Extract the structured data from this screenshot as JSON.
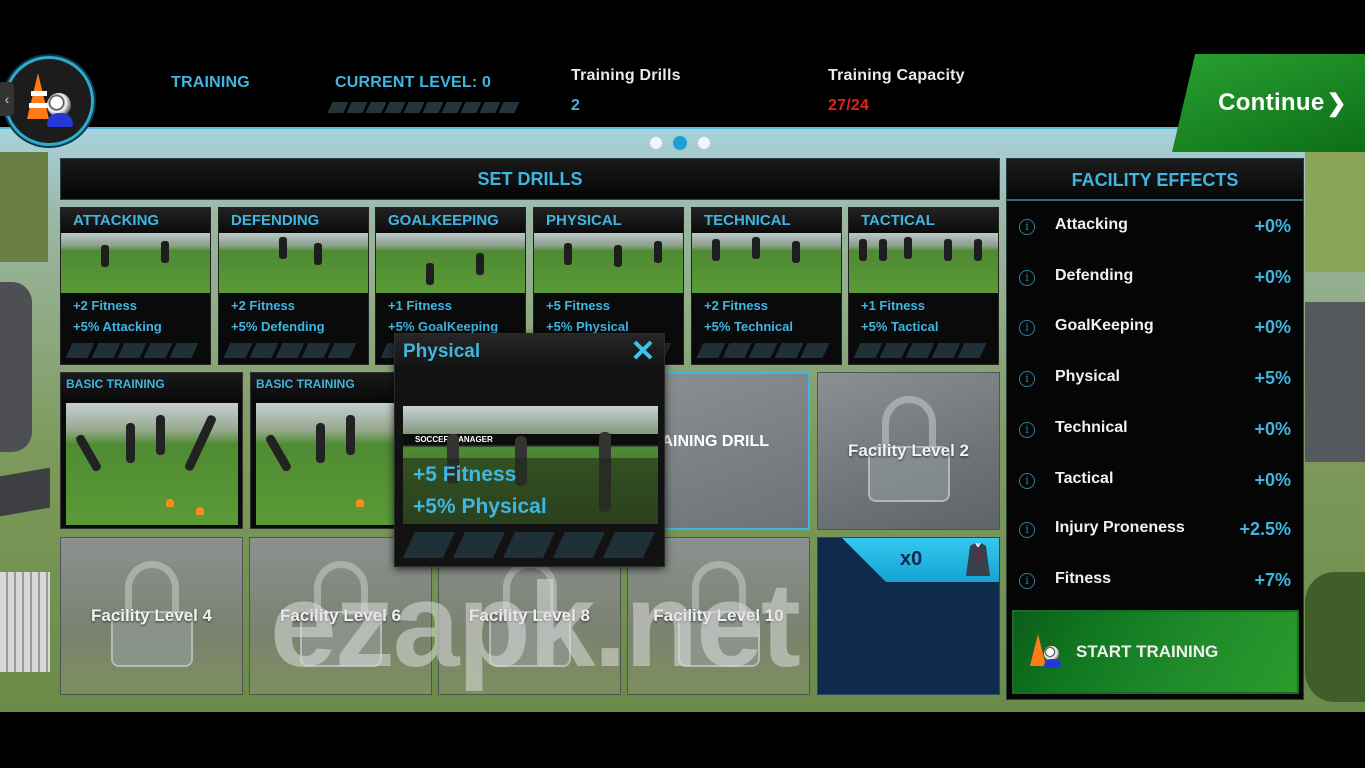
{
  "header": {
    "section_title": "TRAINING",
    "current_level_label": "CURRENT LEVEL: 0",
    "current_level_progress_segments_filled": 0,
    "current_level_progress_segments_total": 10,
    "training_drills_label": "Training Drills",
    "training_drills_value": "2",
    "training_capacity_label": "Training Capacity",
    "training_capacity_value": "27/24",
    "continue_label": "Continue",
    "back_icon": "‹"
  },
  "pagination": {
    "pages": 3,
    "active_index": 1
  },
  "set_drills": {
    "title": "SET DRILLS",
    "categories": [
      {
        "title": "ATTACKING",
        "fitness": "+2 Fitness",
        "bonus": "+5% Attacking",
        "level_filled": 0,
        "level_total": 5
      },
      {
        "title": "DEFENDING",
        "fitness": "+2 Fitness",
        "bonus": "+5% Defending",
        "level_filled": 0,
        "level_total": 5
      },
      {
        "title": "GOALKEEPING",
        "fitness": "+1 Fitness",
        "bonus": "+5% GoalKeeping",
        "level_filled": 0,
        "level_total": 5
      },
      {
        "title": "PHYSICAL",
        "fitness": "+5 Fitness",
        "bonus": "+5% Physical",
        "level_filled": 0,
        "level_total": 5
      },
      {
        "title": "TECHNICAL",
        "fitness": "+2 Fitness",
        "bonus": "+5% Technical",
        "level_filled": 0,
        "level_total": 5
      },
      {
        "title": "TACTICAL",
        "fitness": "+1 Fitness",
        "bonus": "+5% Tactical",
        "level_filled": 0,
        "level_total": 5
      }
    ]
  },
  "slots": {
    "basic_training": [
      {
        "label": "BASIC TRAINING"
      },
      {
        "label": "BASIC TRAINING"
      }
    ],
    "add_drill_label": "ADD TRAINING DRILL +",
    "locked": [
      {
        "label": "Facility Level 2"
      },
      {
        "label": "Facility Level 4"
      },
      {
        "label": "Facility Level 6"
      },
      {
        "label": "Facility Level 8"
      },
      {
        "label": "Facility Level 10"
      }
    ],
    "coach_slot": {
      "count": "x0",
      "icon": "suit-icon"
    }
  },
  "popup": {
    "title": "Physical",
    "close_icon": "✕",
    "fitness": "+5 Fitness",
    "bonus": "+5% Physical",
    "banner_text": "SOCCER MANAGER",
    "level_filled": 0,
    "level_total": 5
  },
  "facility_effects": {
    "title": "FACILITY EFFECTS",
    "info_icon": "i",
    "rows": [
      {
        "label": "Attacking",
        "value": "+0%"
      },
      {
        "label": "Defending",
        "value": "+0%"
      },
      {
        "label": "GoalKeeping",
        "value": "+0%"
      },
      {
        "label": "Physical",
        "value": "+5%"
      },
      {
        "label": "Technical",
        "value": "+0%"
      },
      {
        "label": "Tactical",
        "value": "+0%"
      },
      {
        "label": "Injury Proneness",
        "value": "+2.5%"
      },
      {
        "label": "Fitness",
        "value": "+7%"
      }
    ],
    "start_label": "START TRAINING"
  },
  "watermark": "ezapk.net",
  "colors": {
    "accent": "#3fb6e2",
    "warning": "#e0211c",
    "continue_green": "#1f8a2a",
    "coach_blue": "#0e2a4d"
  }
}
